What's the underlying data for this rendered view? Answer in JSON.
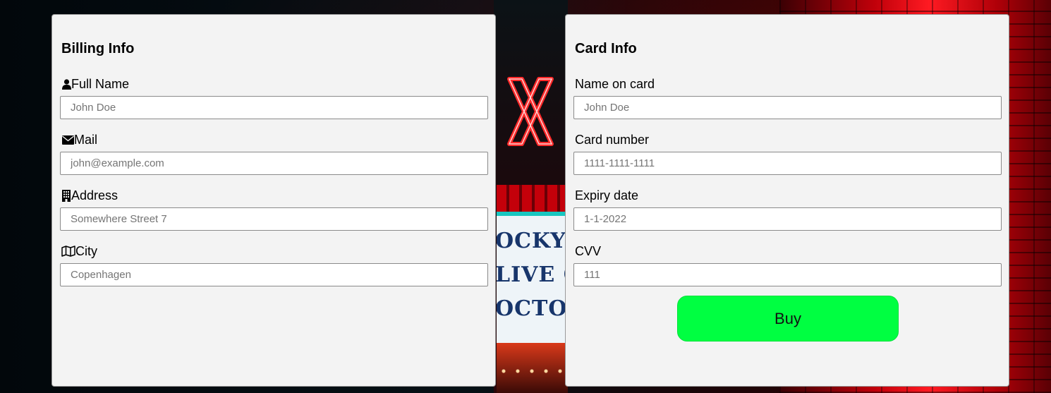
{
  "billing": {
    "title": "Billing Info",
    "fields": [
      {
        "label": "Full Name",
        "icon": "user-icon",
        "placeholder": "John Doe",
        "value": ""
      },
      {
        "label": "Mail",
        "icon": "envelope-icon",
        "placeholder": "john@example.com",
        "value": ""
      },
      {
        "label": "Address",
        "icon": "building-icon",
        "placeholder": "Somewhere Street 7",
        "value": ""
      },
      {
        "label": "City",
        "icon": "map-icon",
        "placeholder": "Copenhagen",
        "value": ""
      }
    ]
  },
  "card": {
    "title": "Card Info",
    "fields": [
      {
        "label": "Name on card",
        "placeholder": "John Doe",
        "value": ""
      },
      {
        "label": "Card number",
        "placeholder": "1111-1111-1111",
        "value": ""
      },
      {
        "label": "Expiry date",
        "placeholder": "1-1-2022",
        "value": ""
      },
      {
        "label": "CVV",
        "placeholder": "111",
        "value": ""
      }
    ],
    "buy_label": "Buy"
  },
  "background": {
    "marquee_lines": [
      "OCKY H",
      "LIVE ON",
      "OCTOBER"
    ]
  },
  "colors": {
    "panel_bg": "#f3f3f3",
    "buy_button": "#00ff41"
  }
}
